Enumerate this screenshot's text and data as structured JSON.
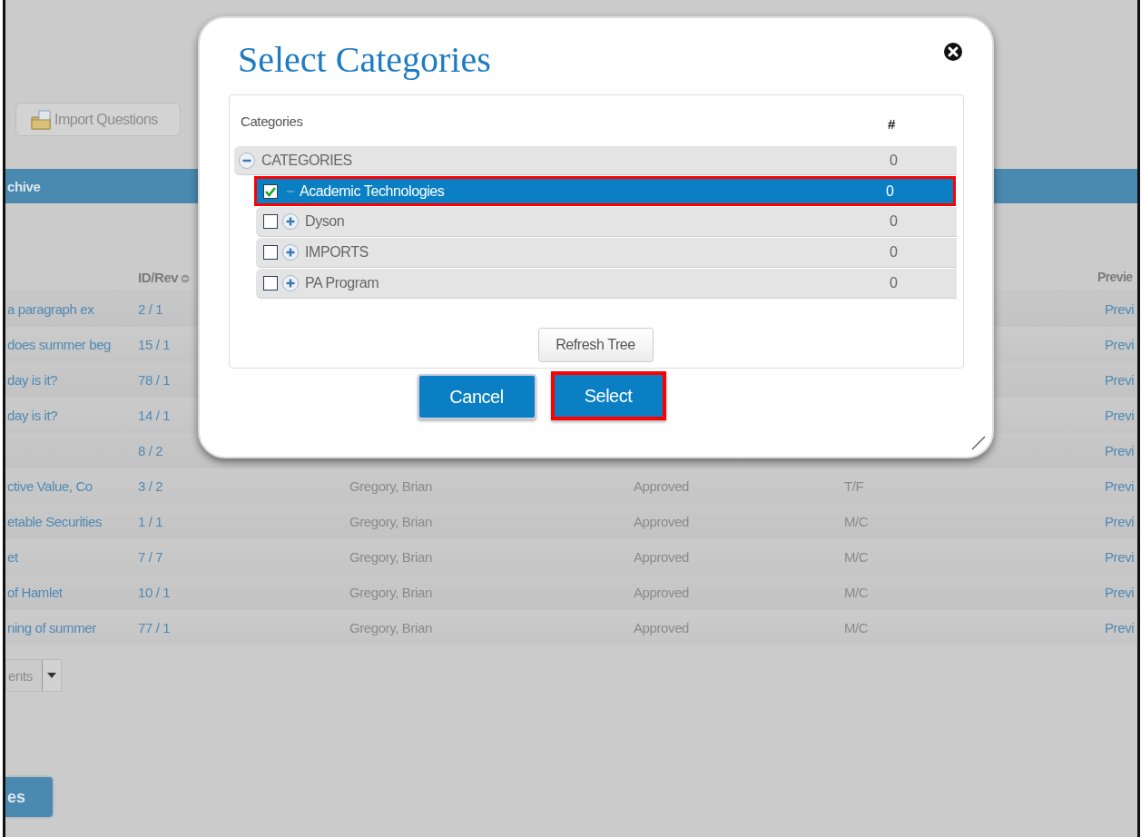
{
  "background": {
    "import_button": "Import Questions",
    "section_bar": "chive",
    "table": {
      "header": {
        "id_rev": "ID/Rev",
        "preview": "Previe"
      },
      "rows": [
        {
          "title": "a paragraph ex",
          "id_rev": "2 / 1",
          "preview": "Previ"
        },
        {
          "title": "does summer beg",
          "id_rev": "15 / 1",
          "preview": "Previ"
        },
        {
          "title": "day is it?",
          "id_rev": "78 / 1",
          "preview": "Previ"
        },
        {
          "title": "day is it?",
          "id_rev": "14 / 1",
          "preview": "Previ"
        },
        {
          "id_rev": "8 / 2",
          "preview": "Previ"
        },
        {
          "title": "ctive Value, Co",
          "id_rev": "3 / 2",
          "author": "Gregory, Brian",
          "status": "Approved",
          "type": "T/F",
          "preview": "Previ"
        },
        {
          "title": "etable Securities",
          "id_rev": "1 / 1",
          "author": "Gregory, Brian",
          "status": "Approved",
          "type": "M/C",
          "preview": "Previ"
        },
        {
          "title": "et",
          "id_rev": "7 / 7",
          "author": "Gregory, Brian",
          "status": "Approved",
          "type": "M/C",
          "preview": "Previ"
        },
        {
          "title": "of Hamlet",
          "id_rev": "10 / 1",
          "author": "Gregory, Brian",
          "status": "Approved",
          "type": "M/C",
          "preview": "Previ"
        },
        {
          "title": "ning of summer",
          "id_rev": "77 / 1",
          "author": "Gregory, Brian",
          "status": "Approved",
          "type": "M/C",
          "preview": "Previ"
        }
      ]
    },
    "page_size_select": "ents",
    "bottom_button": "es"
  },
  "dialog": {
    "title": "Select Categories",
    "panel": {
      "header": "Categories",
      "count_header": "#"
    },
    "tree": {
      "label": "CATEGORIES",
      "count": "0",
      "kind": "collapse",
      "children": [
        {
          "label": "Academic Technologies",
          "count": "0",
          "kind": "leaf",
          "checked": true,
          "selected": true,
          "highlighted": true
        },
        {
          "label": "Dyson",
          "count": "0",
          "kind": "expand",
          "checked": false,
          "selected": false,
          "highlighted": false
        },
        {
          "label": "IMPORTS",
          "count": "0",
          "kind": "expand",
          "checked": false,
          "selected": false,
          "highlighted": false
        },
        {
          "label": "PA Program",
          "count": "0",
          "kind": "expand",
          "checked": false,
          "selected": false,
          "highlighted": false
        }
      ]
    },
    "refresh_button": "Refresh Tree",
    "buttons": [
      {
        "label": "Cancel",
        "highlighted": false
      },
      {
        "label": "Select",
        "highlighted": true
      }
    ]
  }
}
